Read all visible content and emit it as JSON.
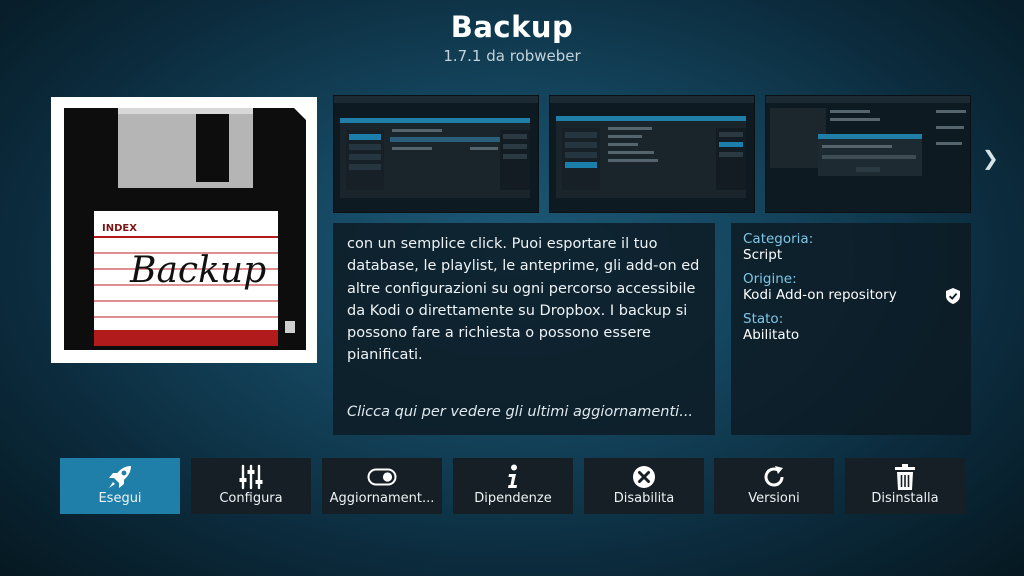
{
  "header": {
    "title": "Backup",
    "subtitle": "1.7.1 da robweber"
  },
  "addon_icon": {
    "name": "floppy-disk-icon",
    "label_index": "INDEX",
    "label_text": "Backup"
  },
  "screenshots": [
    {
      "name": "settings-general",
      "title": "Settings - Backup"
    },
    {
      "name": "settings-scheduling",
      "title": "Settings - Backup"
    },
    {
      "name": "backup-progress",
      "title": "Backup - Mode Backup"
    }
  ],
  "description": {
    "text": "con un semplice click. Puoi esportare il tuo database, le playlist, le anteprime, gli add-on ed altre configurazioni su ogni percorso accessibile da Kodi o direttamente su Dropbox. I backup si possono fare a richiesta o possono essere pianificati.",
    "link": "Clicca qui per vedere gli ultimi aggiornamenti..."
  },
  "info": {
    "category_label": "Categoria:",
    "category_value": "Script",
    "origin_label": "Origine:",
    "origin_value": "Kodi Add-on repository",
    "state_label": "Stato:",
    "state_value": "Abilitato"
  },
  "buttons": [
    {
      "label": "Esegui",
      "icon": "rocket-icon",
      "selected": true
    },
    {
      "label": "Configura",
      "icon": "sliders-icon"
    },
    {
      "label": "Aggiornament...",
      "icon": "toggle-icon"
    },
    {
      "label": "Dipendenze",
      "icon": "info-icon"
    },
    {
      "label": "Disabilita",
      "icon": "close-circle-icon"
    },
    {
      "label": "Versioni",
      "icon": "refresh-icon"
    },
    {
      "label": "Disinstalla",
      "icon": "trash-icon"
    }
  ],
  "colors": {
    "accent": "#1f7fa9",
    "label_blue": "#7fc6e6"
  }
}
